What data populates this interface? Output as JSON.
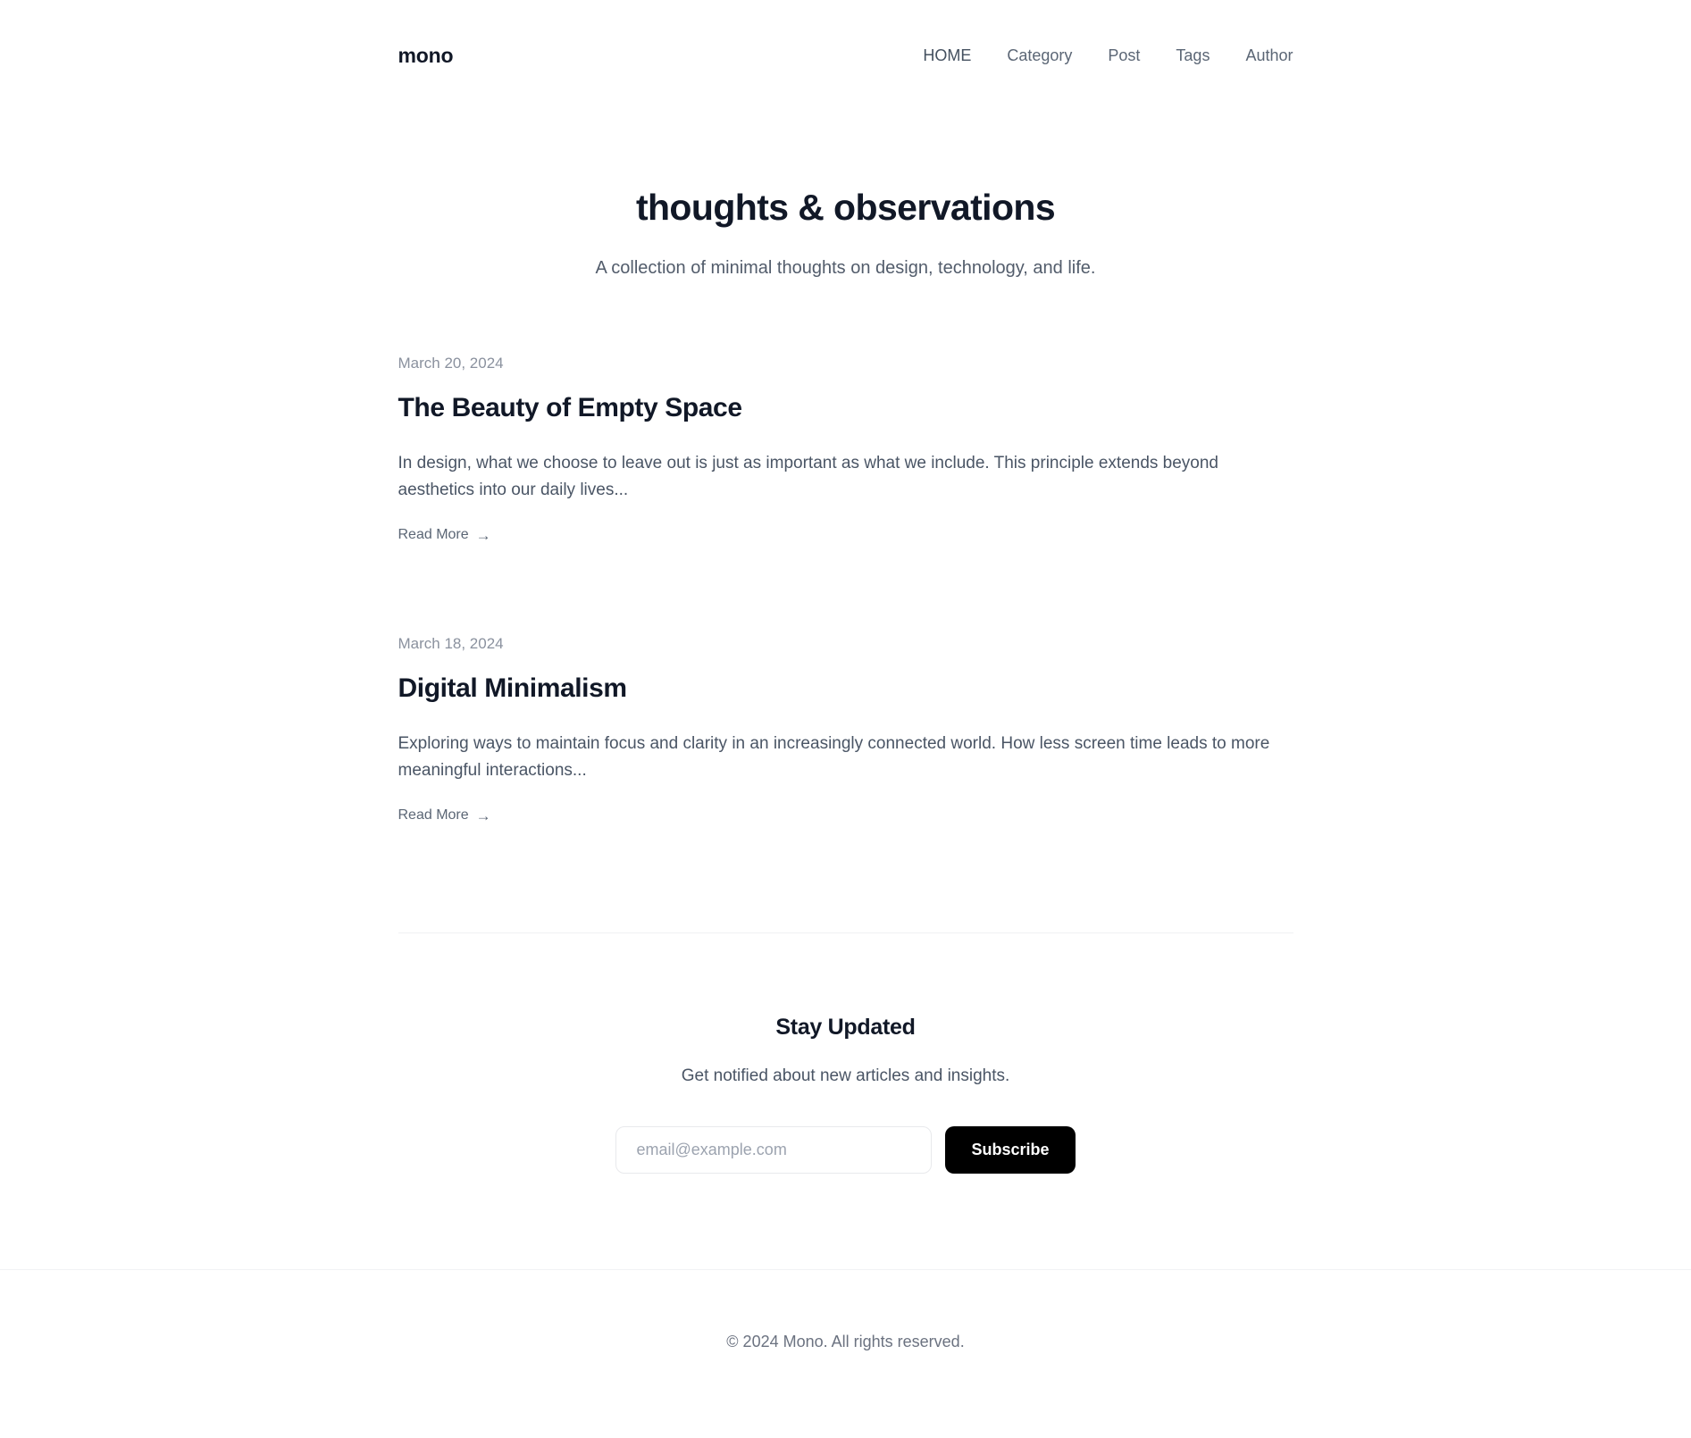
{
  "header": {
    "brand": "mono",
    "nav": [
      {
        "label": "HOME",
        "active": true
      },
      {
        "label": "Category",
        "active": false
      },
      {
        "label": "Post",
        "active": false
      },
      {
        "label": "Tags",
        "active": false
      },
      {
        "label": "Author",
        "active": false
      }
    ]
  },
  "hero": {
    "title": "thoughts & observations",
    "subtitle": "A collection of minimal thoughts on design, technology, and life."
  },
  "posts": [
    {
      "date": "March 20, 2024",
      "title": "The Beauty of Empty Space",
      "excerpt": "In design, what we choose to leave out is just as important as what we include. This principle extends beyond aesthetics into our daily lives...",
      "read_more": "Read More",
      "arrow": "→"
    },
    {
      "date": "March 18, 2024",
      "title": "Digital Minimalism",
      "excerpt": "Exploring ways to maintain focus and clarity in an increasingly connected world. How less screen time leads to more meaningful interactions...",
      "read_more": "Read More",
      "arrow": "→"
    }
  ],
  "newsletter": {
    "title": "Stay Updated",
    "subtitle": "Get notified about new articles and insights.",
    "email_placeholder": "email@example.com",
    "email_value": "",
    "subscribe_label": "Subscribe"
  },
  "footer": {
    "copyright": "© 2024 Mono. All rights reserved."
  },
  "colors": {
    "text_primary": "#111827",
    "text_muted": "#4a5565",
    "text_date": "#8a919e",
    "nav_link": "#5b6675",
    "button_bg": "#000000",
    "button_text": "#ffffff",
    "divider": "#f0f1f3",
    "background": "#ffffff"
  }
}
